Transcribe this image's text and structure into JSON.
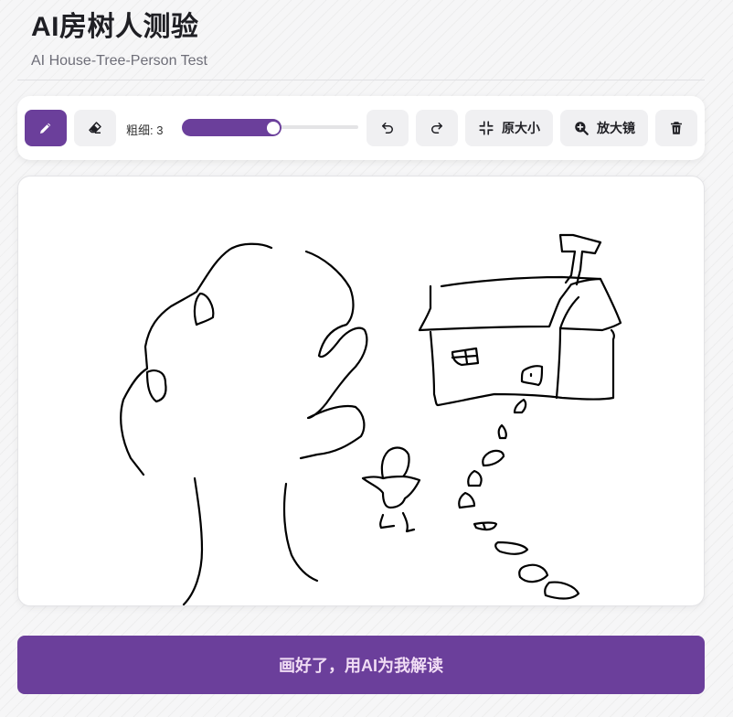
{
  "app": {
    "title": "AI房树人测验",
    "subtitle": "AI House-Tree-Person Test"
  },
  "toolbar": {
    "pen_icon": "pencil-icon",
    "eraser_icon": "eraser-icon",
    "size_label": "粗细: 3",
    "brush_size": 3,
    "undo_icon": "undo-icon",
    "redo_icon": "redo-icon",
    "reset_zoom_label": "原大小",
    "magnifier_label": "放大镜",
    "clear_icon": "trash-icon",
    "active_tool": "pen"
  },
  "submit": {
    "label": "画好了，用AI为我解读"
  },
  "colors": {
    "accent": "#6b3f9b",
    "button_bg": "#f0f0f2",
    "submit_text": "#f0dcf4"
  }
}
